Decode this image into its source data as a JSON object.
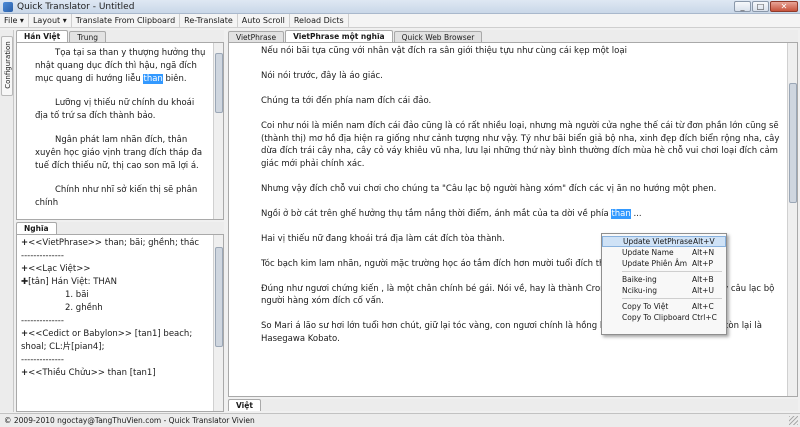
{
  "window": {
    "title": "Quick Translator - Untitled",
    "min": "_",
    "max": "□",
    "close": "✕"
  },
  "menu": [
    "File",
    "Layout",
    "Translate From Clipboard",
    "Re-Translate",
    "Auto Scroll",
    "Reload Dicts"
  ],
  "sidebar": {
    "configuration": "Configuration"
  },
  "topleft_tabs": [
    "Hán Việt",
    "Trung"
  ],
  "hanviet_paragraphs": [
    [
      "Tọa tại sa than y thượng hưởng thụ nhật quang dục đích thì hậu, ngã đích mục quang di hướng liễu ",
      "than",
      " biên."
    ],
    [
      "Lưỡng vị thiếu nữ chính du khoái địa tố trứ sa đích thành bảo."
    ],
    [
      "Ngân phát lam nhãn đích, thân xuyên học giáo vịnh trang đích tháp đa tuế đích thiếu nữ, thị cao son mã lợi á."
    ],
    [
      "Chính như nhĩ sở kiến thị sẽ phân chính"
    ]
  ],
  "nghia_tab": "Nghĩa",
  "nghia": {
    "vietphrase": "<<VietPhrase>> than; bãi; ghềnh; thác",
    "sep": "--------------",
    "lacviet_head": "<<Lạc Việt>>",
    "lacviet_entry": "[tân] Hán Việt: THAN",
    "lacviet_defs": [
      "1. bãi",
      "2. ghềnh"
    ],
    "cedict": "<<Cedict or Babylon>>  [tan1] beach; shoal; CL:片[pian4];",
    "thieuchuu": "<<Thiều Chửu>> than [tan1]"
  },
  "main_tabs": [
    "VietPhrase",
    "VietPhrase một nghĩa",
    "Quick Web Browser"
  ],
  "main_paragraphs": [
    "Nếu nói bãi tựa cũng với nhân vật đích ra sân giới thiệu tựu như cùng cái kẹp một loại",
    "Nói nói trước, đây là áo giác.",
    "Chúng ta tới đến phía nam đích cái đảo.",
    "Coi như nói là miền nam đích cái đảo cũng là có rất nhiều loại, nhưng mà người cửa nghe thế cái từ đơn phần lớn cũng sẽ (thành thị) mơ hồ địa hiện ra giống như cảnh tượng như vậy. Tỷ như bãi biển giả bộ nha, xinh đẹp đích biển rộng nha, cây dừa đích trái cây nha, cây cỏ váy khiêu vũ nha, lưu lại những thứ này bình thường đích mùa hè chỗ vui chơi loại đích cảm giác mới phải chính xác.",
    "Nhưng vậy đích chỗ vui chơi cho chúng ta \"Câu lạc bộ người hàng xóm\" đích các vị ăn no hướng một phen.",
    [
      "Ngồi ở bờ cát trên ghế hưởng thụ tắm nắng thời điểm, ánh mắt của ta dời về phía ",
      "than",
      " ..."
    ],
    "Hai vị thiếu nữ đang khoái trá địa làm cát đích tòa thành.",
    "Tóc bạch kim lam nhãn, người mặc trường học áo tắm đích hơn mười tuổi đích thiếu nữ",
    "Đúng như ngươi chứng kiến , là một chân chính bé gái. Nói về, hay là thành Cronika nữ sĩ, đồng thời cũng vậy câu lạc bộ người hàng xóm đích cố vấn.",
    "So Mari á lão sư hơi lớn tuổi hơn chút, giữ lại tóc vàng, con ngươi chính là hồng lam về kinh dị đích thiếu nữ, còn lại là Hasegawa Kobato."
  ],
  "context_menu": [
    {
      "label": "Update VietPhrase",
      "shortcut": "Alt+V"
    },
    {
      "label": "Update Name",
      "shortcut": "Alt+N"
    },
    {
      "label": "Update Phiên Âm",
      "shortcut": "Alt+P"
    },
    {
      "label": "Baike-ing",
      "shortcut": "Alt+B"
    },
    {
      "label": "Nciku-ing",
      "shortcut": "Alt+U"
    },
    {
      "label": "Copy To Việt",
      "shortcut": "Alt+C"
    },
    {
      "label": "Copy To Clipboard",
      "shortcut": "Ctrl+C"
    }
  ],
  "bottom_tab": "Việt",
  "status": "© 2009-2010 ngoctay@TangThuVien.com - Quick Translator Vivien"
}
